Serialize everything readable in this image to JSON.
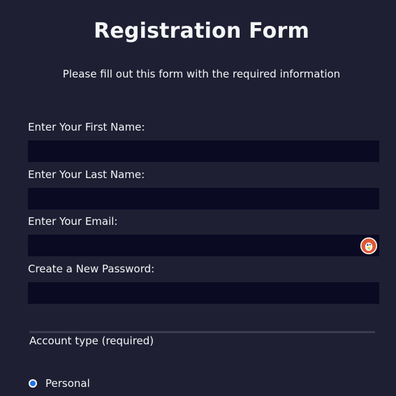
{
  "form": {
    "title": "Registration Form",
    "subtitle": "Please fill out this form with the required information",
    "fields": [
      {
        "label": "Enter Your First Name:",
        "value": "",
        "placeholder": ""
      },
      {
        "label": "Enter Your Last Name:",
        "value": "",
        "placeholder": ""
      },
      {
        "label": "Enter Your Email:",
        "value": "",
        "placeholder": ""
      },
      {
        "label": "Create a New Password:",
        "value": "",
        "placeholder": ""
      }
    ],
    "account_type": {
      "legend": "Account type (required)",
      "options": [
        {
          "label": "Personal",
          "checked": true
        }
      ]
    }
  },
  "colors": {
    "background": "#1f1f33",
    "input_background": "#0a0a23",
    "text": "#f5f6f7",
    "divider": "#3b3b4f",
    "radio_accent": "#1a73e8",
    "autofill_badge": "#de5833"
  },
  "icons": {
    "email_autofill": "duckduckgo-autofill-icon"
  }
}
